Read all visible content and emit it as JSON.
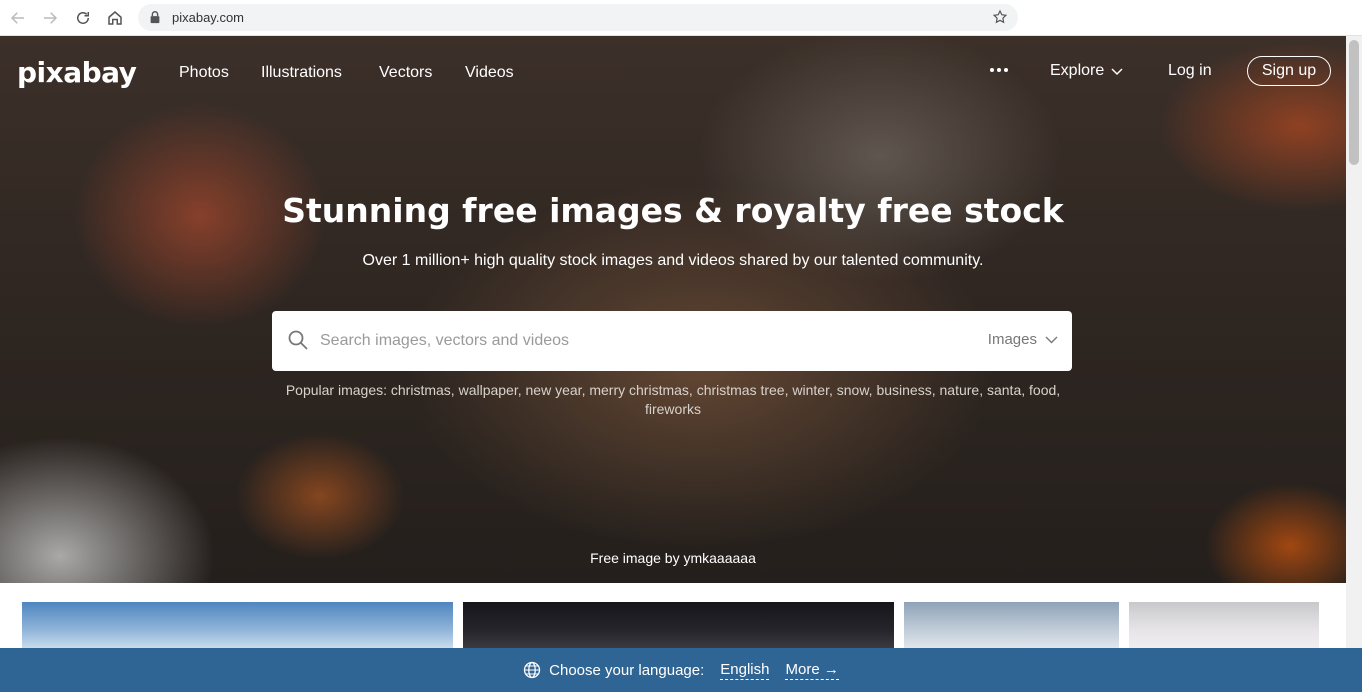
{
  "browser": {
    "url": "pixabay.com",
    "icons": [
      "back-icon",
      "forward-icon",
      "reload-icon",
      "home-icon",
      "lock-icon",
      "star-icon"
    ]
  },
  "header": {
    "logo": "pixabay",
    "nav": [
      "Photos",
      "Illustrations",
      "Vectors",
      "Videos"
    ],
    "explore": "Explore",
    "login": "Log in",
    "signup": "Sign up"
  },
  "hero": {
    "title": "Stunning free images & royalty free stock",
    "subtitle": "Over 1 million+ high quality stock images and videos shared by our talented community.",
    "credit": "Free image by ymkaaaaaa"
  },
  "search": {
    "placeholder": "Search images, vectors and videos",
    "type": "Images"
  },
  "popular": {
    "label": "Popular images:",
    "tags": [
      "christmas",
      "wallpaper",
      "new year",
      "merry christmas",
      "christmas tree",
      "winter",
      "snow",
      "business",
      "nature",
      "santa",
      "food",
      "fireworks"
    ]
  },
  "language_bar": {
    "prompt": "Choose your language:",
    "current": "English",
    "more": "More →"
  },
  "colors": {
    "language_bar": "#2f6594",
    "hero_dark": "#3b302a"
  }
}
